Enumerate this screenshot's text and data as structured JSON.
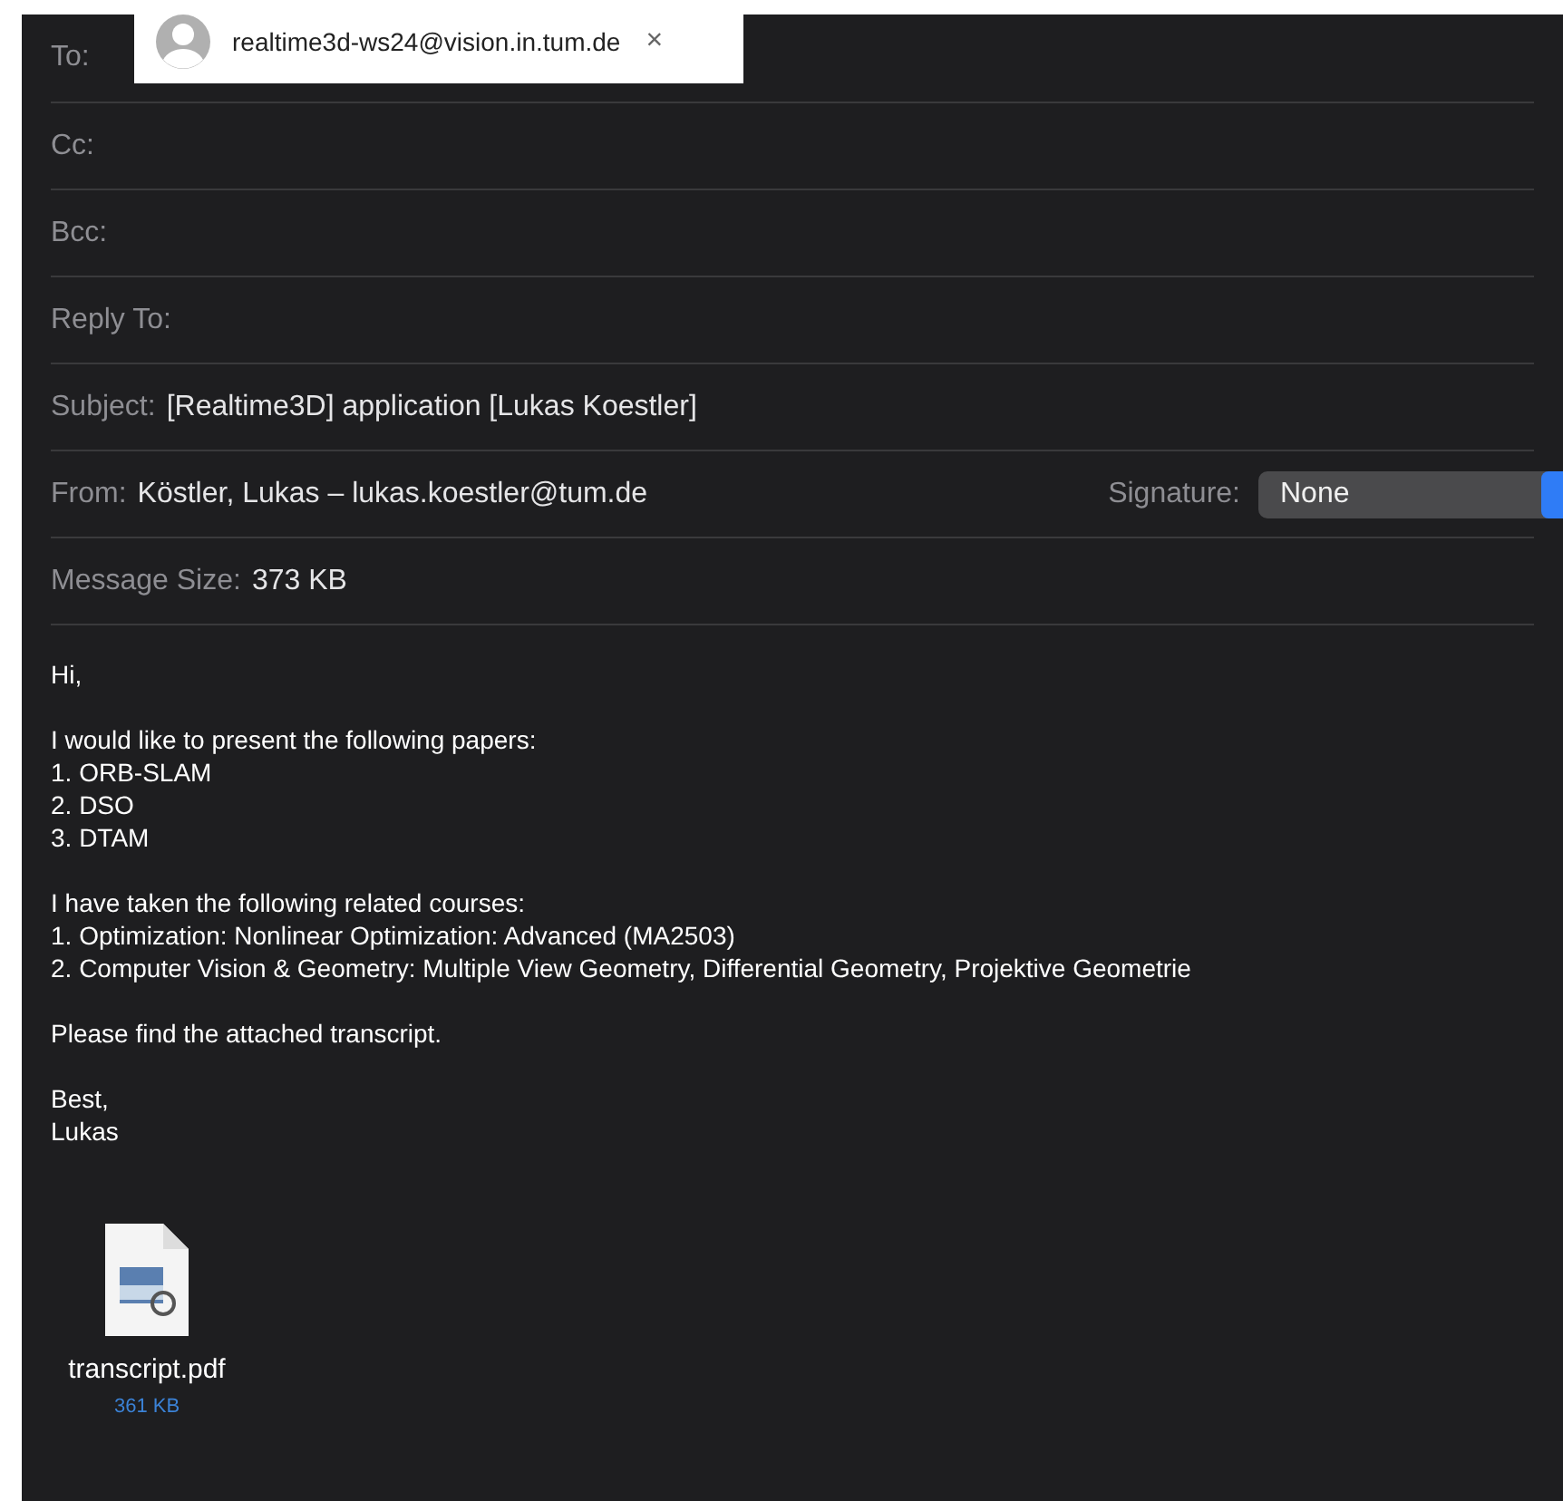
{
  "header_fields": [
    {
      "label": "To:",
      "recipient": {
        "address": "realtime3d-ws24@vision.in.tum.de",
        "remove": "×"
      }
    },
    {
      "label": "Cc:"
    },
    {
      "label": "Bcc:"
    },
    {
      "label": "Reply To:"
    },
    {
      "label": "Subject:",
      "value": "[Realtime3D] application [Lukas Koestler]"
    },
    {
      "label": "From:",
      "value": "Köstler, Lukas – lukas.koestler@tum.de",
      "signature": {
        "label": "Signature:",
        "value": "None"
      }
    },
    {
      "label": "Message Size:",
      "value": "373 KB"
    }
  ],
  "body": [
    [
      "Hi,"
    ],
    [
      "I would like to present the following papers:",
      "1. ORB-SLAM",
      "2. DSO",
      "3. DTAM"
    ],
    [
      "I have taken the following related courses:",
      "1. Optimization: Nonlinear Optimization: Advanced (MA2503)",
      "2. Computer Vision & Geometry: Multiple View Geometry, Differential Geometry, Projektive Geometrie"
    ],
    [
      "Please find the attached transcript."
    ],
    [
      "Best,",
      "Lukas"
    ]
  ],
  "attachment": {
    "name": "transcript.pdf",
    "size": "361 KB"
  }
}
